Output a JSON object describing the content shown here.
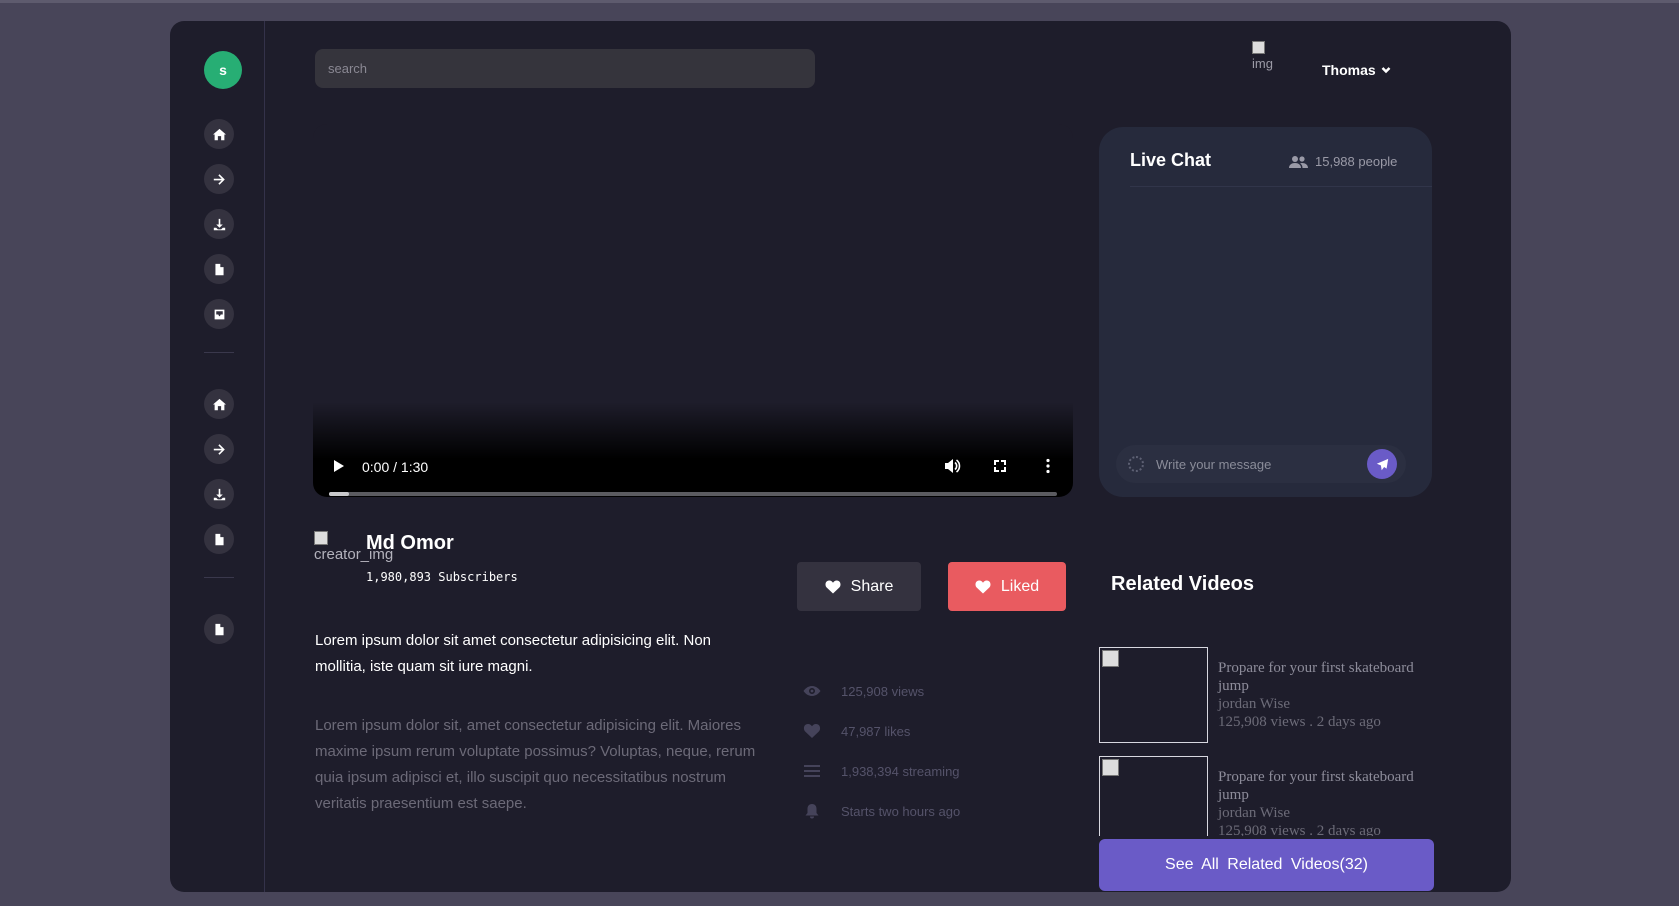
{
  "logo": {
    "letter": "s"
  },
  "search": {
    "placeholder": "search"
  },
  "user": {
    "img_alt": "img",
    "name": "Thomas"
  },
  "player": {
    "time": "0:00 / 1:30",
    "progress": 0.027
  },
  "chat": {
    "title": "Live Chat",
    "people": "15,988 people",
    "input_placeholder": "Write your message"
  },
  "creator": {
    "img_alt": "creator_img",
    "name": "Md Omor",
    "subscribers": "1,980,893 Subscribers"
  },
  "description": {
    "primary": "Lorem ipsum dolor sit amet consectetur adipisicing elit. Non mollitia, iste quam sit iure magni.",
    "secondary": "Lorem ipsum dolor sit, amet consectetur adipisicing elit. Maiores maxime ipsum rerum voluptate possimus? Voluptas, neque, rerum quia ipsum adipisci et, illo suscipit quo necessitatibus nostrum veritatis praesentium est saepe."
  },
  "actions": {
    "share": "Share",
    "liked": "Liked"
  },
  "stats": {
    "views": "125,908 views",
    "likes": "47,987 likes",
    "streaming": "1,938,394 streaming",
    "starts": "Starts two hours ago"
  },
  "related": {
    "title": "Related Videos",
    "items": [
      {
        "title": "Propare for your first skateboard jump",
        "author": "jordan Wise",
        "meta": "125,908 views . 2 days ago"
      },
      {
        "title": "Propare for your first skateboard jump",
        "author": "jordan Wise",
        "meta": "125,908 views . 2 days ago"
      }
    ],
    "see_all": "See All Related Videos(32)"
  },
  "colors": {
    "accent": "#6a5bc7",
    "liked": "#e95b60",
    "logo": "#27ae74"
  }
}
